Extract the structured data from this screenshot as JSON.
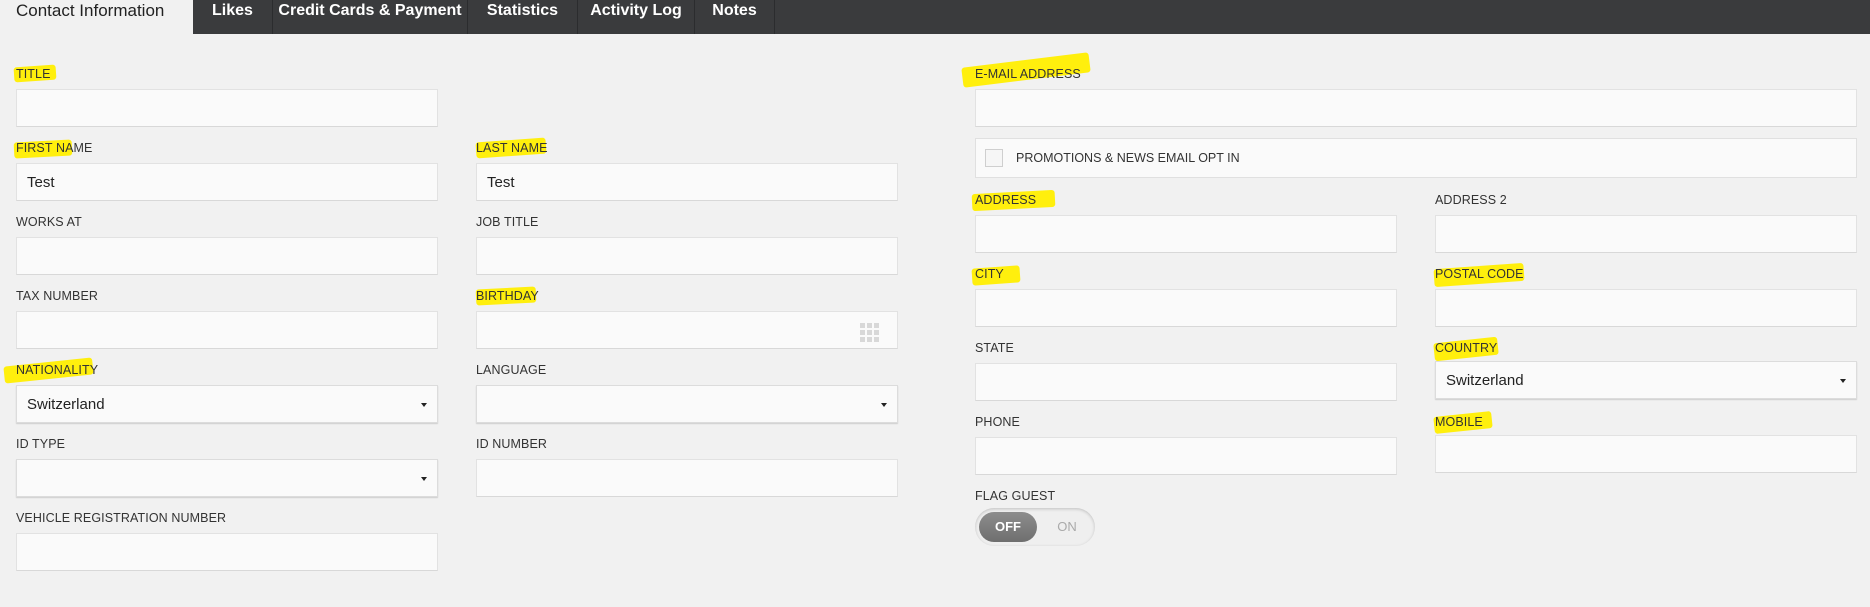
{
  "tabs": [
    {
      "label": "Contact Information"
    },
    {
      "label": "Likes"
    },
    {
      "label": "Credit Cards & Payment"
    },
    {
      "label": "Statistics"
    },
    {
      "label": "Activity Log"
    },
    {
      "label": "Notes"
    }
  ],
  "fields": {
    "title": {
      "label": "TITLE",
      "value": ""
    },
    "first_name": {
      "label": "FIRST NAME",
      "value": "Test"
    },
    "last_name": {
      "label": "LAST NAME",
      "value": "Test"
    },
    "works_at": {
      "label": "WORKS AT",
      "value": ""
    },
    "job_title": {
      "label": "JOB TITLE",
      "value": ""
    },
    "tax_number": {
      "label": "TAX NUMBER",
      "value": ""
    },
    "birthday": {
      "label": "BIRTHDAY",
      "value": "",
      "icon": "calendar-grid-icon"
    },
    "nationality": {
      "label": "NATIONALITY",
      "value": "Switzerland"
    },
    "language": {
      "label": "LANGUAGE",
      "value": ""
    },
    "id_type": {
      "label": "ID TYPE",
      "value": ""
    },
    "id_number": {
      "label": "ID NUMBER",
      "value": ""
    },
    "vehicle_registration": {
      "label": "VEHICLE REGISTRATION NUMBER",
      "value": ""
    },
    "email": {
      "label": "E-MAIL ADDRESS",
      "value": ""
    },
    "promotions_optin": {
      "label": "PROMOTIONS & NEWS EMAIL OPT IN",
      "checked": false
    },
    "address": {
      "label": "ADDRESS",
      "value": ""
    },
    "address2": {
      "label": "ADDRESS 2",
      "value": ""
    },
    "city": {
      "label": "CITY",
      "value": ""
    },
    "postal_code": {
      "label": "POSTAL CODE",
      "value": ""
    },
    "state": {
      "label": "STATE",
      "value": ""
    },
    "country": {
      "label": "COUNTRY",
      "value": "Switzerland"
    },
    "phone": {
      "label": "PHONE",
      "value": ""
    },
    "mobile": {
      "label": "MOBILE",
      "value": ""
    },
    "flag_guest": {
      "label": "FLAG GUEST",
      "off_label": "OFF",
      "on_label": "ON",
      "state": "OFF"
    }
  },
  "colors": {
    "tabbar": "#3a3b3d",
    "highlight": "#ffee00",
    "background": "#f1f1f1"
  }
}
